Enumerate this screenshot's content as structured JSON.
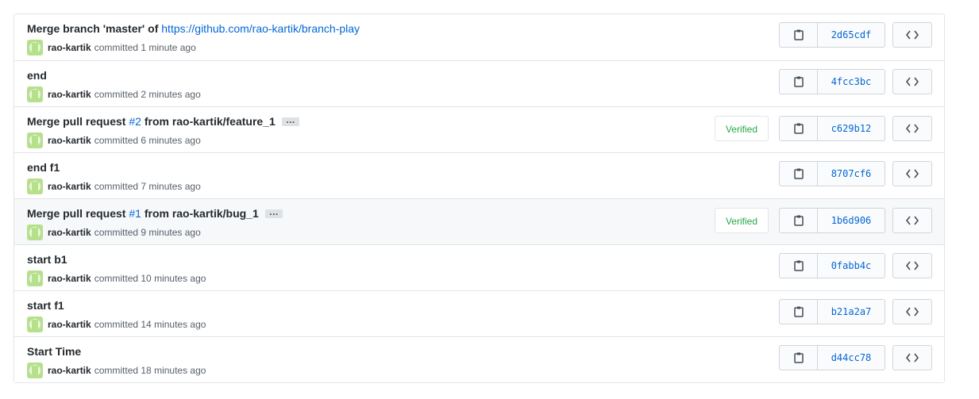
{
  "commits": [
    {
      "title_prefix": "Merge branch 'master' of ",
      "title_link": "https://github.com/rao-kartik/branch-play",
      "title_suffix": "",
      "author": "rao-kartik",
      "meta": "committed 1 minute ago",
      "sha": "2d65cdf",
      "verified": ""
    },
    {
      "title_prefix": "end",
      "author": "rao-kartik",
      "meta": "committed 2 minutes ago",
      "sha": "4fcc3bc",
      "verified": ""
    },
    {
      "title_prefix": "Merge pull request ",
      "title_link": "#2",
      "title_suffix": " from rao-kartik/feature_1",
      "ellipsis": "…",
      "author": "rao-kartik",
      "meta": "committed 6 minutes ago",
      "sha": "c629b12",
      "verified": "Verified"
    },
    {
      "title_prefix": "end f1",
      "author": "rao-kartik",
      "meta": "committed 7 minutes ago",
      "sha": "8707cf6",
      "verified": ""
    },
    {
      "title_prefix": "Merge pull request ",
      "title_link": "#1",
      "title_suffix": " from rao-kartik/bug_1",
      "ellipsis": "…",
      "author": "rao-kartik",
      "meta": "committed 9 minutes ago",
      "sha": "1b6d906",
      "verified": "Verified"
    },
    {
      "title_prefix": "start b1",
      "author": "rao-kartik",
      "meta": "committed 10 minutes ago",
      "sha": "0fabb4c",
      "verified": ""
    },
    {
      "title_prefix": "start f1",
      "author": "rao-kartik",
      "meta": "committed 14 minutes ago",
      "sha": "b21a2a7",
      "verified": ""
    },
    {
      "title_prefix": "Start Time",
      "author": "rao-kartik",
      "meta": "committed 18 minutes ago",
      "sha": "d44cc78",
      "verified": ""
    }
  ],
  "icons": {
    "copy": "clipboard-icon",
    "browse": "code-icon"
  },
  "colors": {
    "link": "#0366d6",
    "verified": "#28a745",
    "border": "#e1e4e8",
    "hover_row": "#f6f8fa"
  }
}
